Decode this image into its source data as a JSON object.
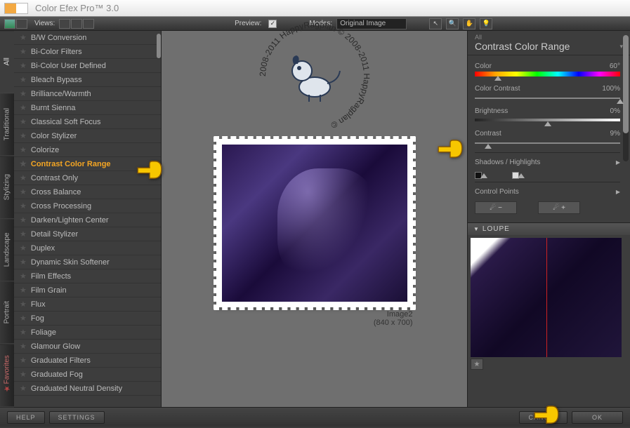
{
  "titlebar": {
    "title": "Color Efex Pro™ 3.0"
  },
  "toolbar": {
    "views_label": "Views:",
    "preview_label": "Preview:",
    "modes_label": "Modes:",
    "mode_value": "Original Image"
  },
  "sidebar": {
    "tabs": [
      {
        "label": "All"
      },
      {
        "label": "Traditional"
      },
      {
        "label": "Stylizing"
      },
      {
        "label": "Landscape"
      },
      {
        "label": "Portrait"
      },
      {
        "label": "Favorites"
      }
    ],
    "filters": [
      {
        "label": "B/W Conversion"
      },
      {
        "label": "Bi-Color Filters"
      },
      {
        "label": "Bi-Color User Defined"
      },
      {
        "label": "Bleach Bypass"
      },
      {
        "label": "Brilliance/Warmth"
      },
      {
        "label": "Burnt Sienna"
      },
      {
        "label": "Classical Soft Focus"
      },
      {
        "label": "Color Stylizer"
      },
      {
        "label": "Colorize"
      },
      {
        "label": "Contrast Color Range",
        "selected": true
      },
      {
        "label": "Contrast Only"
      },
      {
        "label": "Cross Balance"
      },
      {
        "label": "Cross Processing"
      },
      {
        "label": "Darken/Lighten Center"
      },
      {
        "label": "Detail Stylizer"
      },
      {
        "label": "Duplex"
      },
      {
        "label": "Dynamic Skin Softener"
      },
      {
        "label": "Film Effects"
      },
      {
        "label": "Film Grain"
      },
      {
        "label": "Flux"
      },
      {
        "label": "Fog"
      },
      {
        "label": "Foliage"
      },
      {
        "label": "Glamour Glow"
      },
      {
        "label": "Graduated Filters"
      },
      {
        "label": "Graduated Fog"
      },
      {
        "label": "Graduated Neutral Density"
      }
    ]
  },
  "preview": {
    "image_name": "Image2",
    "dimensions": "(840 x 700)",
    "watermark": "2008-2011 HappyRagplan © 2008-2011 HappyRagplan ©"
  },
  "panel": {
    "all_label": "All",
    "title": "Contrast Color Range",
    "sliders": {
      "color": {
        "label": "Color",
        "value": "60°"
      },
      "color_contrast": {
        "label": "Color Contrast",
        "value": "100%"
      },
      "brightness": {
        "label": "Brightness",
        "value": "0%"
      },
      "contrast": {
        "label": "Contrast",
        "value": "9%"
      }
    },
    "shadows_label": "Shadows / Highlights",
    "control_points_label": "Control Points",
    "cp_minus": "−",
    "cp_plus": "+"
  },
  "loupe": {
    "header": "LOUPE"
  },
  "footer": {
    "help": "HELP",
    "settings": "SETTINGS",
    "cancel": "CANCEL",
    "ok": "OK"
  }
}
